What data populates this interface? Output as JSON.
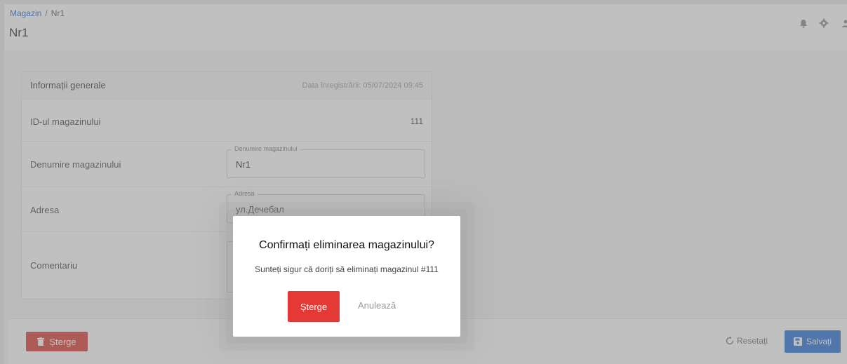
{
  "breadcrumb": {
    "parent": "Magazin",
    "separator": "/",
    "current": "Nr1"
  },
  "page": {
    "title": "Nr1"
  },
  "header_icons": [
    "bell-icon",
    "gear-icon",
    "user-icon"
  ],
  "card": {
    "title": "Informații generale",
    "registration": "Data înregistrării: 05/07/2024 09:45",
    "rows": [
      {
        "label": "ID-ul magazinului",
        "value": "111"
      },
      {
        "label": "Denumire magazinului",
        "field_legend": "Denumire magazinului",
        "field_value": "Nr1"
      },
      {
        "label": "Adresa",
        "field_legend": "Adresa",
        "field_value": "ул.Дечебал"
      },
      {
        "label": "Comentariu",
        "field_value": ""
      }
    ]
  },
  "footer": {
    "delete_label": "Șterge",
    "reset_label": "Resetați",
    "save_label": "Salvați"
  },
  "modal": {
    "title": "Confirmați eliminarea magazinului?",
    "text": "Sunteți sigur că doriți să eliminați magazinul #111",
    "confirm_label": "Șterge",
    "cancel_label": "Anulează"
  },
  "colors": {
    "primary": "#1e6ad6",
    "danger": "#e53935",
    "danger_dark": "#d9342b"
  }
}
